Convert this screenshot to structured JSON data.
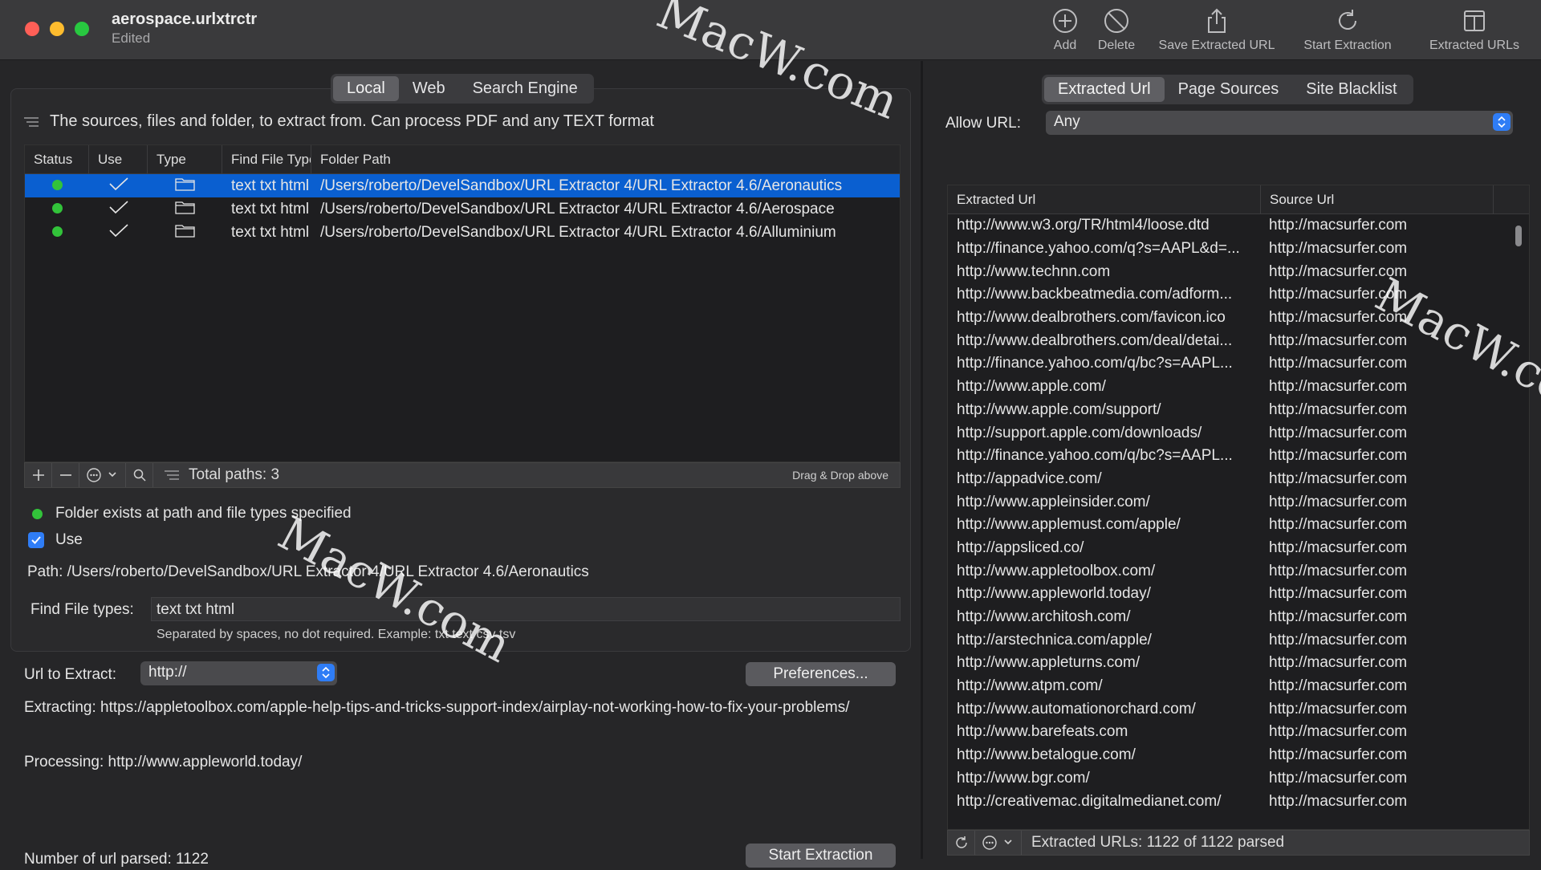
{
  "window": {
    "title": "aerospace.urlxtrctr",
    "subtitle": "Edited"
  },
  "toolbar": {
    "add": "Add",
    "delete": "Delete",
    "save": "Save Extracted URL",
    "start": "Start Extraction",
    "extracted": "Extracted URLs"
  },
  "left": {
    "tabs": [
      "Local",
      "Web",
      "Search Engine"
    ],
    "description": "The sources, files and folder, to extract from. Can process PDF and any TEXT format",
    "columns": [
      "Status",
      "Use",
      "Type",
      "Find File Type",
      "Folder Path"
    ],
    "rows": [
      {
        "types": "text txt html",
        "path": "/Users/roberto/DevelSandbox/URL Extractor 4/URL Extractor 4.6/Aeronautics"
      },
      {
        "types": "text txt html",
        "path": "/Users/roberto/DevelSandbox/URL Extractor 4/URL Extractor 4.6/Aerospace"
      },
      {
        "types": "text txt html",
        "path": "/Users/roberto/DevelSandbox/URL Extractor 4/URL Extractor 4.6/Alluminium"
      }
    ],
    "total_paths": "Total paths: 3",
    "drag_drop": "Drag & Drop above",
    "status_text": "Folder exists at path and file types specified",
    "use_label": "Use",
    "path_text": "Path:  /Users/roberto/DevelSandbox/URL Extractor 4/URL Extractor 4.6/Aeronautics",
    "find_types_label": "Find File types:",
    "find_types_value": "text txt html",
    "hint": "Separated by spaces, no dot required. Example: txt text csv tsv",
    "url_label": "Url to Extract:",
    "url_value": "http://",
    "prefs": "Preferences...",
    "extracting": "Extracting: https://appletoolbox.com/apple-help-tips-and-tricks-support-index/airplay-not-working-how-to-fix-your-problems/",
    "processing": "Processing: http://www.appleworld.today/",
    "parsed": "Number of url parsed: 1122",
    "start_btn": "Start Extraction"
  },
  "right": {
    "tabs": [
      "Extracted Url",
      "Page Sources",
      "Site Blacklist"
    ],
    "allow_label": "Allow URL:",
    "allow_value": "Any",
    "columns": [
      "Extracted Url",
      "Source Url"
    ],
    "rows": [
      [
        "http://www.w3.org/TR/html4/loose.dtd",
        "http://macsurfer.com"
      ],
      [
        "http://finance.yahoo.com/q?s=AAPL&d=...",
        "http://macsurfer.com"
      ],
      [
        "http://www.technn.com",
        "http://macsurfer.com"
      ],
      [
        "http://www.backbeatmedia.com/adform...",
        "http://macsurfer.com"
      ],
      [
        "http://www.dealbrothers.com/favicon.ico",
        "http://macsurfer.com"
      ],
      [
        "http://www.dealbrothers.com/deal/detai...",
        "http://macsurfer.com"
      ],
      [
        "http://finance.yahoo.com/q/bc?s=AAPL...",
        "http://macsurfer.com"
      ],
      [
        "http://www.apple.com/",
        "http://macsurfer.com"
      ],
      [
        "http://www.apple.com/support/",
        "http://macsurfer.com"
      ],
      [
        "http://support.apple.com/downloads/",
        "http://macsurfer.com"
      ],
      [
        "http://finance.yahoo.com/q/bc?s=AAPL...",
        "http://macsurfer.com"
      ],
      [
        "http://appadvice.com/",
        "http://macsurfer.com"
      ],
      [
        "http://www.appleinsider.com/",
        "http://macsurfer.com"
      ],
      [
        "http://www.applemust.com/apple/",
        "http://macsurfer.com"
      ],
      [
        "http://appsliced.co/",
        "http://macsurfer.com"
      ],
      [
        "http://www.appletoolbox.com/",
        "http://macsurfer.com"
      ],
      [
        "http://www.appleworld.today/",
        "http://macsurfer.com"
      ],
      [
        "http://www.architosh.com/",
        "http://macsurfer.com"
      ],
      [
        "http://arstechnica.com/apple/",
        "http://macsurfer.com"
      ],
      [
        "http://www.appleturns.com/",
        "http://macsurfer.com"
      ],
      [
        "http://www.atpm.com/",
        "http://macsurfer.com"
      ],
      [
        "http://www.automationorchard.com/",
        "http://macsurfer.com"
      ],
      [
        "http://www.barefeats.com",
        "http://macsurfer.com"
      ],
      [
        "http://www.betalogue.com/",
        "http://macsurfer.com"
      ],
      [
        "http://www.bgr.com/",
        "http://macsurfer.com"
      ],
      [
        "http://creativemac.digitalmedianet.com/",
        "http://macsurfer.com"
      ]
    ],
    "footer": "Extracted URLs: 1122 of  1122 parsed"
  },
  "watermark": "MacW.com"
}
